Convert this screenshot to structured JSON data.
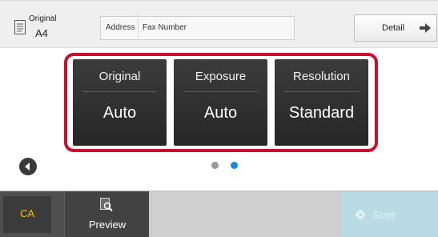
{
  "header": {
    "original_label": "Original",
    "original_size": "A4",
    "address_label": "Address",
    "address_value": "Fax Number",
    "detail_label": "Detail"
  },
  "settings": {
    "tiles": [
      {
        "title": "Original",
        "value": "Auto"
      },
      {
        "title": "Exposure",
        "value": "Auto"
      },
      {
        "title": "Resolution",
        "value": "Standard"
      }
    ]
  },
  "pager": {
    "current_page": 2,
    "total_pages": 2
  },
  "footer": {
    "ca_label": "CA",
    "preview_label": "Preview",
    "start_label": "Start"
  },
  "colors": {
    "selection_frame": "#c8102e",
    "active_dot": "#1a8ad8",
    "ca_text": "#f5c000",
    "start_button": "#b9dbe4"
  },
  "icons": [
    "original-doc-icon",
    "right-arrow-icon",
    "back-arrow-icon",
    "preview-magnifier-icon",
    "start-diamond-icon"
  ]
}
